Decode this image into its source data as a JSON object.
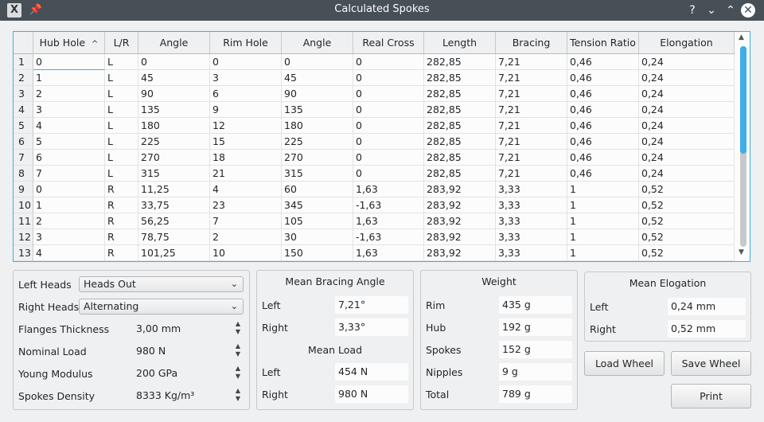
{
  "window": {
    "title": "Calculated Spokes",
    "app_icon_glyph": "X",
    "pin_icon_glyph": "📌",
    "help_glyph": "?",
    "min_glyph": "⌄",
    "max_glyph": "⌃",
    "close_glyph": "✕"
  },
  "table": {
    "sort_indicator": "^",
    "headers": [
      "Hub Hole",
      "L/R",
      "Angle",
      "Rim Hole",
      "Angle",
      "Real Cross",
      "Length",
      "Bracing",
      "Tension Ratio",
      "Elongation"
    ],
    "rows": [
      {
        "n": "1",
        "c": [
          "0",
          "L",
          "0",
          "0",
          "0",
          "0",
          "282,85",
          "7,21",
          "0,46",
          "0,24"
        ]
      },
      {
        "n": "2",
        "c": [
          "1",
          "L",
          "45",
          "3",
          "45",
          "0",
          "282,85",
          "7,21",
          "0,46",
          "0,24"
        ]
      },
      {
        "n": "3",
        "c": [
          "2",
          "L",
          "90",
          "6",
          "90",
          "0",
          "282,85",
          "7,21",
          "0,46",
          "0,24"
        ]
      },
      {
        "n": "4",
        "c": [
          "3",
          "L",
          "135",
          "9",
          "135",
          "0",
          "282,85",
          "7,21",
          "0,46",
          "0,24"
        ]
      },
      {
        "n": "5",
        "c": [
          "4",
          "L",
          "180",
          "12",
          "180",
          "0",
          "282,85",
          "7,21",
          "0,46",
          "0,24"
        ]
      },
      {
        "n": "6",
        "c": [
          "5",
          "L",
          "225",
          "15",
          "225",
          "0",
          "282,85",
          "7,21",
          "0,46",
          "0,24"
        ]
      },
      {
        "n": "7",
        "c": [
          "6",
          "L",
          "270",
          "18",
          "270",
          "0",
          "282,85",
          "7,21",
          "0,46",
          "0,24"
        ]
      },
      {
        "n": "8",
        "c": [
          "7",
          "L",
          "315",
          "21",
          "315",
          "0",
          "282,85",
          "7,21",
          "0,46",
          "0,24"
        ]
      },
      {
        "n": "9",
        "c": [
          "0",
          "R",
          "11,25",
          "4",
          "60",
          "1,63",
          "283,92",
          "3,33",
          "1",
          "0,52"
        ]
      },
      {
        "n": "10",
        "c": [
          "1",
          "R",
          "33,75",
          "23",
          "345",
          "-1,63",
          "283,92",
          "3,33",
          "1",
          "0,52"
        ]
      },
      {
        "n": "11",
        "c": [
          "2",
          "R",
          "56,25",
          "7",
          "105",
          "1,63",
          "283,92",
          "3,33",
          "1",
          "0,52"
        ]
      },
      {
        "n": "12",
        "c": [
          "3",
          "R",
          "78,75",
          "2",
          "30",
          "-1,63",
          "283,92",
          "3,33",
          "1",
          "0,52"
        ]
      },
      {
        "n": "13",
        "c": [
          "4",
          "R",
          "101,25",
          "10",
          "150",
          "1,63",
          "283,92",
          "3,33",
          "1",
          "0,52"
        ]
      }
    ]
  },
  "settings": {
    "left_heads_label": "Left Heads",
    "left_heads_value": "Heads Out",
    "right_heads_label": "Right Heads",
    "right_heads_value": "Alternating",
    "flanges_label": "Flanges Thickness",
    "flanges_value": "3,00 mm",
    "load_label": "Nominal Load",
    "load_value": "980 N",
    "young_label": "Young Modulus",
    "young_value": "200 GPa",
    "density_label": "Spokes Density",
    "density_value": "8333 Kg/m³"
  },
  "bracing": {
    "title": "Mean Bracing Angle",
    "left_label": "Left",
    "left_value": "7,21°",
    "right_label": "Right",
    "right_value": "3,33°",
    "load_title": "Mean Load",
    "load_left_label": "Left",
    "load_left_value": "454 N",
    "load_right_label": "Right",
    "load_right_value": "980 N"
  },
  "weight": {
    "title": "Weight",
    "rim_label": "Rim",
    "rim_value": "435 g",
    "hub_label": "Hub",
    "hub_value": "192 g",
    "spokes_label": "Spokes",
    "spokes_value": "152 g",
    "nipples_label": "Nipples",
    "nipples_value": "9 g",
    "total_label": "Total",
    "total_value": "789 g"
  },
  "elongation": {
    "title": "Mean Elogation",
    "left_label": "Left",
    "left_value": "0,24 mm",
    "right_label": "Right",
    "right_value": "0,52 mm"
  },
  "buttons": {
    "load": "Load Wheel",
    "save": "Save Wheel",
    "print": "Print"
  },
  "icons": {
    "dropdown": "⌄",
    "spin_up": "▲",
    "spin_down": "▼",
    "scroll_up": "▲",
    "scroll_down": "▼"
  },
  "colors": {
    "titlebar": "#475057",
    "accent": "#3daee9",
    "background": "#eff0f1"
  }
}
